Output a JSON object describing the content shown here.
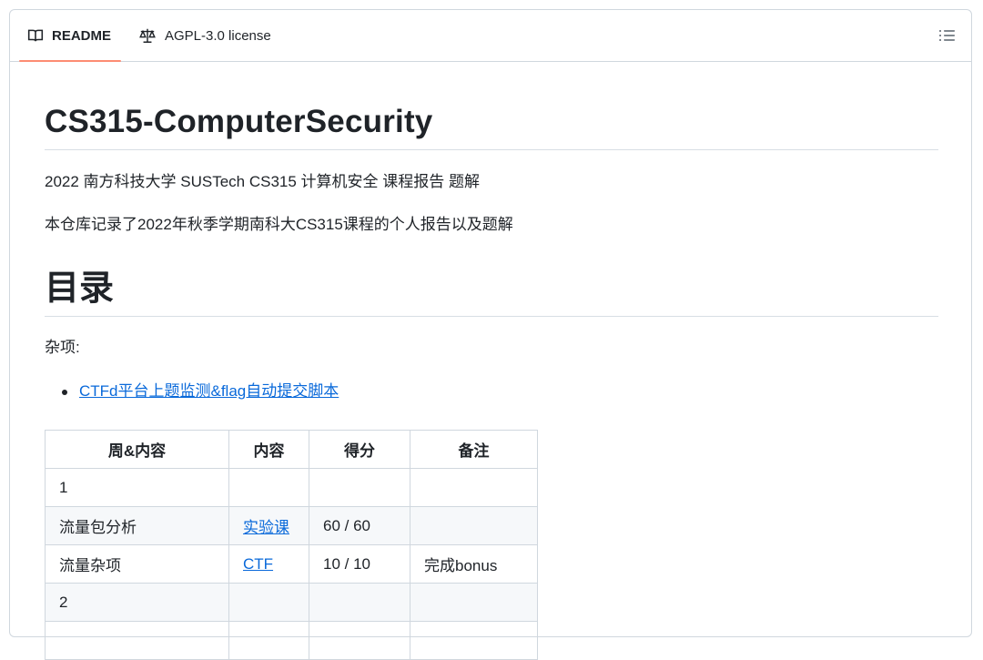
{
  "tabs": {
    "readme_label": "README",
    "license_label": "AGPL-3.0 license",
    "readme_icon": "book-icon",
    "license_icon": "law-icon",
    "outline_icon": "list-unordered-icon"
  },
  "readme": {
    "title": "CS315-ComputerSecurity",
    "subtitle": "2022 南方科技大学 SUSTech CS315 计算机安全 课程报告 题解",
    "description": "本仓库记录了2022年秋季学期南科大CS315课程的个人报告以及题解",
    "toc_heading": "目录",
    "misc_label": "杂项:",
    "misc_links": [
      "CTFd平台上题监测&flag自动提交脚本"
    ]
  },
  "table": {
    "headers": [
      "周&内容",
      "内容",
      "得分",
      "备注"
    ],
    "rows": [
      {
        "c1": "1",
        "c2": "",
        "c3": "",
        "c4": ""
      },
      {
        "c1": "流量包分析",
        "c2": "实验课",
        "c3": "60 / 60",
        "c4": ""
      },
      {
        "c1": "流量杂项",
        "c2": "CTF",
        "c3": "10 / 10",
        "c4": "完成bonus"
      },
      {
        "c1": "2",
        "c2": "",
        "c3": "",
        "c4": ""
      },
      {
        "c1": "",
        "c2": "",
        "c3": "",
        "c4": ""
      }
    ]
  },
  "colors": {
    "link": "#0969da",
    "tab_underline": "#fd8c73",
    "border": "#d0d7de"
  }
}
